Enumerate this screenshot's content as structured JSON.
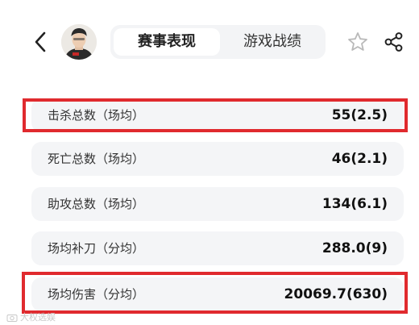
{
  "header": {
    "back_icon": "chevron-left-icon",
    "tabs": [
      {
        "label": "赛事表现",
        "active": true
      },
      {
        "label": "游戏战绩",
        "active": false
      }
    ],
    "star_icon": "star-icon",
    "share_icon": "share-icon"
  },
  "stats": [
    {
      "label": "击杀总数（场均）",
      "value": "55(2.5)",
      "highlighted": true
    },
    {
      "label": "死亡总数（场均）",
      "value": "46(2.1)",
      "highlighted": false
    },
    {
      "label": "助攻总数（场均）",
      "value": "134(6.1)",
      "highlighted": false
    },
    {
      "label": "场均补刀（分均）",
      "value": "288.0(9)",
      "highlighted": false
    },
    {
      "label": "场均伤害（分均）",
      "value": "20069.7(630)",
      "highlighted": true
    }
  ],
  "watermark": {
    "text": "大权选娱"
  },
  "colors": {
    "highlight": "#e02a2e",
    "row_bg": "#f4f5f7",
    "tab_bg": "#f3f4f6"
  }
}
